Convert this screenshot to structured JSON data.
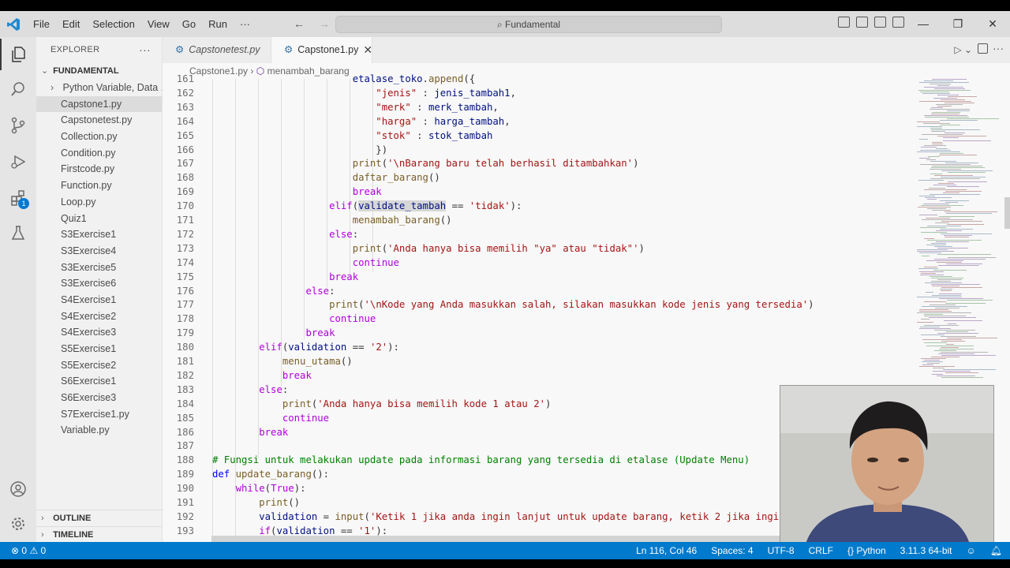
{
  "menu": [
    "File",
    "Edit",
    "Selection",
    "View",
    "Go",
    "Run",
    "···"
  ],
  "search_title": "Fundamental",
  "explorer": {
    "header": "EXPLORER",
    "more": "···",
    "folder": "FUNDAMENTAL",
    "subfolder": "Python Variable, Data ...",
    "files": [
      "Capstone1.py",
      "Capstonetest.py",
      "Collection.py",
      "Condition.py",
      "Firstcode.py",
      "Function.py",
      "Loop.py",
      "Quiz1",
      "S3Exercise1",
      "S3Exercise4",
      "S3Exercise5",
      "S3Exercise6",
      "S4Exercise1",
      "S4Exercise2",
      "S4Exercise3",
      "S5Exercise1",
      "S5Exercise2",
      "S6Exercise1",
      "S6Exercise3",
      "S7Exercise1.py",
      "Variable.py"
    ],
    "outline": "OUTLINE",
    "timeline": "TIMELINE"
  },
  "activity_badge": "1",
  "tabs": [
    {
      "label": "Capstonetest.py"
    },
    {
      "label": "Capstone1.py"
    }
  ],
  "breadcrumb": {
    "file": "Capstone1.py",
    "symbol": "menambah_barang"
  },
  "code": {
    "lines": [
      {
        "n": "161",
        "t": "                        etalase_toko.append({"
      },
      {
        "n": "162",
        "t": "                            \"jenis\" : jenis_tambah1,"
      },
      {
        "n": "163",
        "t": "                            \"merk\" : merk_tambah,"
      },
      {
        "n": "164",
        "t": "                            \"harga\" : harga_tambah,"
      },
      {
        "n": "165",
        "t": "                            \"stok\" : stok_tambah"
      },
      {
        "n": "166",
        "t": "                            })"
      },
      {
        "n": "167",
        "t": "                        print('\\nBarang baru telah berhasil ditambahkan')"
      },
      {
        "n": "168",
        "t": "                        daftar_barang()"
      },
      {
        "n": "169",
        "t": "                        break"
      },
      {
        "n": "170",
        "t": "                    elif(validate_tambah == 'tidak'):"
      },
      {
        "n": "171",
        "t": "                        menambah_barang()"
      },
      {
        "n": "172",
        "t": "                    else:"
      },
      {
        "n": "173",
        "t": "                        print('Anda hanya bisa memilih \"ya\" atau \"tidak\"')"
      },
      {
        "n": "174",
        "t": "                        continue"
      },
      {
        "n": "175",
        "t": "                    break"
      },
      {
        "n": "176",
        "t": "                else:"
      },
      {
        "n": "177",
        "t": "                    print('\\nKode yang Anda masukkan salah, silakan masukkan kode jenis yang tersedia')"
      },
      {
        "n": "178",
        "t": "                    continue"
      },
      {
        "n": "179",
        "t": "                break"
      },
      {
        "n": "180",
        "t": "        elif(validation == '2'):"
      },
      {
        "n": "181",
        "t": "            menu_utama()"
      },
      {
        "n": "182",
        "t": "            break"
      },
      {
        "n": "183",
        "t": "        else:"
      },
      {
        "n": "184",
        "t": "            print('Anda hanya bisa memilih kode 1 atau 2')"
      },
      {
        "n": "185",
        "t": "            continue"
      },
      {
        "n": "186",
        "t": "        break"
      },
      {
        "n": "187",
        "t": ""
      },
      {
        "n": "188",
        "t": "# Fungsi untuk melakukan update pada informasi barang yang tersedia di etalase (Update Menu)"
      },
      {
        "n": "189",
        "t": "def update_barang():"
      },
      {
        "n": "190",
        "t": "    while(True):"
      },
      {
        "n": "191",
        "t": "        print()"
      },
      {
        "n": "192",
        "t": "        validation = input('Ketik 1 jika anda ingin lanjut untuk update barang, ketik 2 jika ingin"
      },
      {
        "n": "193",
        "t": "        if(validation == '1'):"
      }
    ],
    "highlight_word": "validate_tambah"
  },
  "colors": {
    "keyword": "#af00db",
    "control": "#af00db",
    "function": "#795e26",
    "string": "#a31515",
    "comment": "#008000",
    "variable": "#001080",
    "statusbar": "#007acc"
  },
  "status": {
    "errors": "0",
    "warnings": "0",
    "position": "Ln 116, Col 46",
    "spaces": "Spaces: 4",
    "encoding": "UTF-8",
    "eol": "CRLF",
    "language": "Python",
    "interpreter": "3.11.3 64-bit"
  }
}
